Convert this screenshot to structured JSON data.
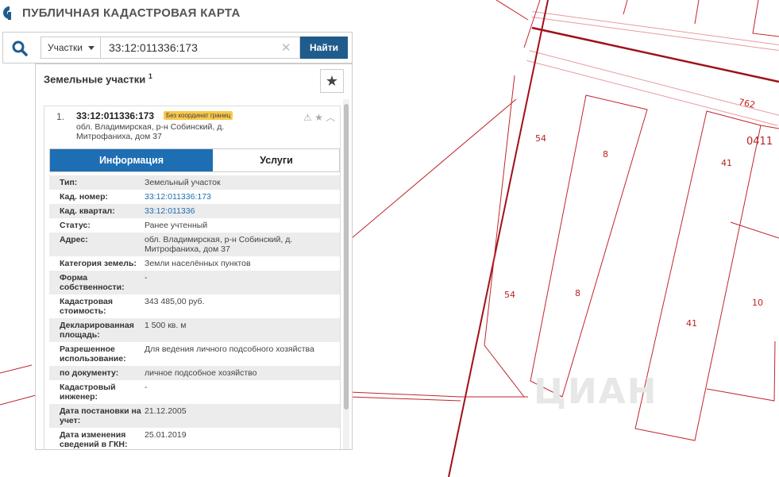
{
  "header": {
    "title": "ПУБЛИЧНАЯ КАДАСТРОВАЯ КАРТА"
  },
  "search": {
    "type_select": "Участки",
    "value": "33:12:011336:173",
    "find_label": "Найти"
  },
  "panel": {
    "title": "Земельные участки",
    "count": "1"
  },
  "card": {
    "index": "1.",
    "cad_number": "33:12:011336:173",
    "badge": "Без координат границ",
    "address": "обл. Владимирская, р-н Собинский, д. Митрофаниха, дом 37",
    "tabs": [
      "Информация",
      "Услуги"
    ]
  },
  "info_rows": [
    {
      "k": "Тип:",
      "v": "Земельный участок"
    },
    {
      "k": "Кад. номер:",
      "v": "33:12:011336:173"
    },
    {
      "k": "Кад. квартал:",
      "v": "33:12:011336"
    },
    {
      "k": "Статус:",
      "v": "Ранее учтенный"
    },
    {
      "k": "Адрес:",
      "v": "обл. Владимирская, р-н Собинский, д. Митрофаниха, дом 37"
    },
    {
      "k": "Категория земель:",
      "v": "Земли населённых пунктов"
    },
    {
      "k": "Форма собственности:",
      "v": "-"
    },
    {
      "k": "Кадастровая стоимость:",
      "v": "343 485,00 руб."
    },
    {
      "k": "Декларированная площадь:",
      "v": "1 500 кв. м"
    },
    {
      "k": "Разрешенное использование:",
      "v": "Для ведения личного подсобного хозяйства"
    },
    {
      "k": "по документу:",
      "v": "личное подсобное хозяйство"
    },
    {
      "k": "Кадастровый инженер:",
      "v": "-"
    },
    {
      "k": "Дата постановки на учет:",
      "v": "21.12.2005"
    },
    {
      "k": "Дата изменения сведений в ГКН:",
      "v": "25.01.2019"
    }
  ],
  "map": {
    "labels": [
      "762",
      "54",
      "8",
      "41",
      "0411",
      "54",
      "8",
      "10",
      "41"
    ],
    "watermark": "ЦИАН"
  },
  "colors": {
    "accent": "#1e6eb3",
    "button": "#1f5c8c",
    "parcel_line": "#b22222",
    "badge": "#f8c84a"
  }
}
